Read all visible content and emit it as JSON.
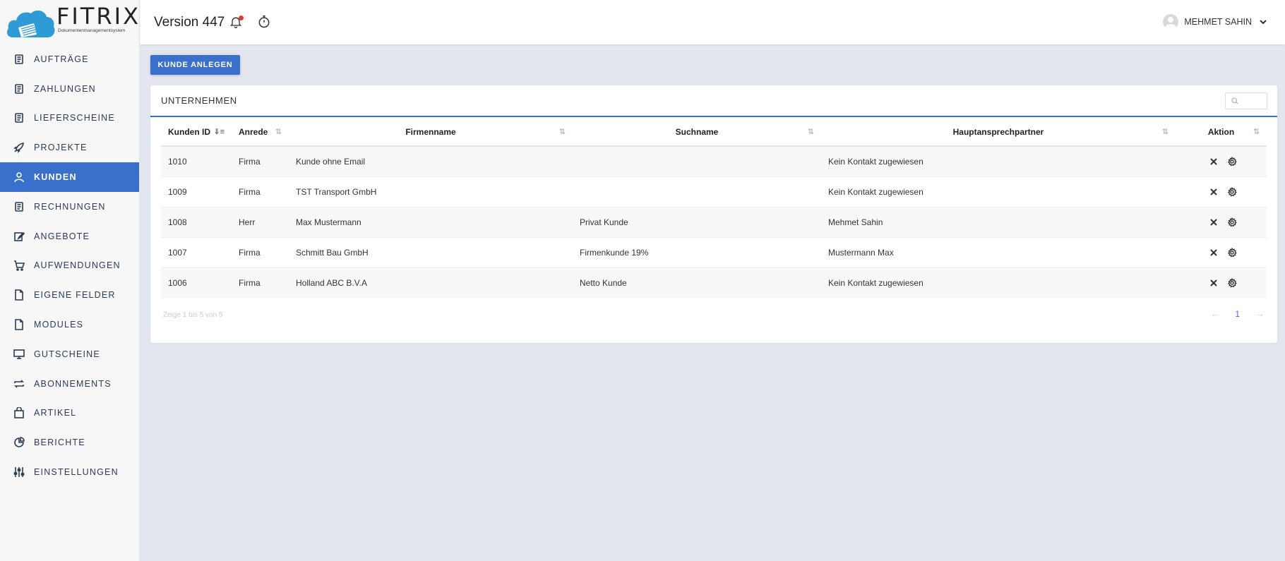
{
  "brand": {
    "name": "FITRIX",
    "subtitle": "Dokumentenmanagementsystem"
  },
  "header": {
    "version": "Version 447",
    "user_name": "MEHMET SAHIN"
  },
  "sidebar": {
    "items": [
      {
        "label": "AUFTRÄGE",
        "icon": "document-icon"
      },
      {
        "label": "ZAHLUNGEN",
        "icon": "document-icon"
      },
      {
        "label": "LIEFERSCHEINE",
        "icon": "document-icon"
      },
      {
        "label": "PROJEKTE",
        "icon": "rocket-icon"
      },
      {
        "label": "KUNDEN",
        "icon": "user-icon"
      },
      {
        "label": "RECHNUNGEN",
        "icon": "document-icon"
      },
      {
        "label": "ANGEBOTE",
        "icon": "edit-icon"
      },
      {
        "label": "AUFWENDUNGEN",
        "icon": "cart-icon"
      },
      {
        "label": "EIGENE FELDER",
        "icon": "file-icon"
      },
      {
        "label": "MODULES",
        "icon": "file-icon"
      },
      {
        "label": "GUTSCHEINE",
        "icon": "monitor-icon"
      },
      {
        "label": "ABONNEMENTS",
        "icon": "repeat-icon"
      },
      {
        "label": "ARTIKEL",
        "icon": "bag-icon"
      },
      {
        "label": "BERICHTE",
        "icon": "pie-chart-icon"
      },
      {
        "label": "EINSTELLUNGEN",
        "icon": "sliders-icon"
      }
    ],
    "active": "KUNDEN"
  },
  "main": {
    "add_button": "KUNDE ANLEGEN",
    "card_title": "UNTERNEHMEN",
    "search_placeholder": "",
    "columns": [
      "Kunden ID",
      "Anrede",
      "Firmenname",
      "Suchname",
      "Hauptansprechpartner",
      "Aktion"
    ],
    "rows": [
      {
        "id": "1010",
        "anrede": "Firma",
        "firmenname": "Kunde ohne Email",
        "suchname": "",
        "kontakt": "Kein Kontakt zugewiesen"
      },
      {
        "id": "1009",
        "anrede": "Firma",
        "firmenname": "TST Transport GmbH",
        "suchname": "",
        "kontakt": "Kein Kontakt zugewiesen"
      },
      {
        "id": "1008",
        "anrede": "Herr",
        "firmenname": "Max Mustermann",
        "suchname": "Privat Kunde",
        "kontakt": "Mehmet Sahin"
      },
      {
        "id": "1007",
        "anrede": "Firma",
        "firmenname": "Schmitt Bau GmbH",
        "suchname": "Firmenkunde 19%",
        "kontakt": "Mustermann Max"
      },
      {
        "id": "1006",
        "anrede": "Firma",
        "firmenname": "Holland ABC B.V.A",
        "suchname": "Netto Kunde",
        "kontakt": "Kein Kontakt zugewiesen"
      }
    ],
    "footer_info": "Zeige 1 bis 5 von 5",
    "pagination": {
      "prev": "←",
      "current": "1",
      "next": "→"
    }
  },
  "colors": {
    "accent": "#3a6fcc",
    "background": "#e3e6ee",
    "notification": "#e53935"
  }
}
